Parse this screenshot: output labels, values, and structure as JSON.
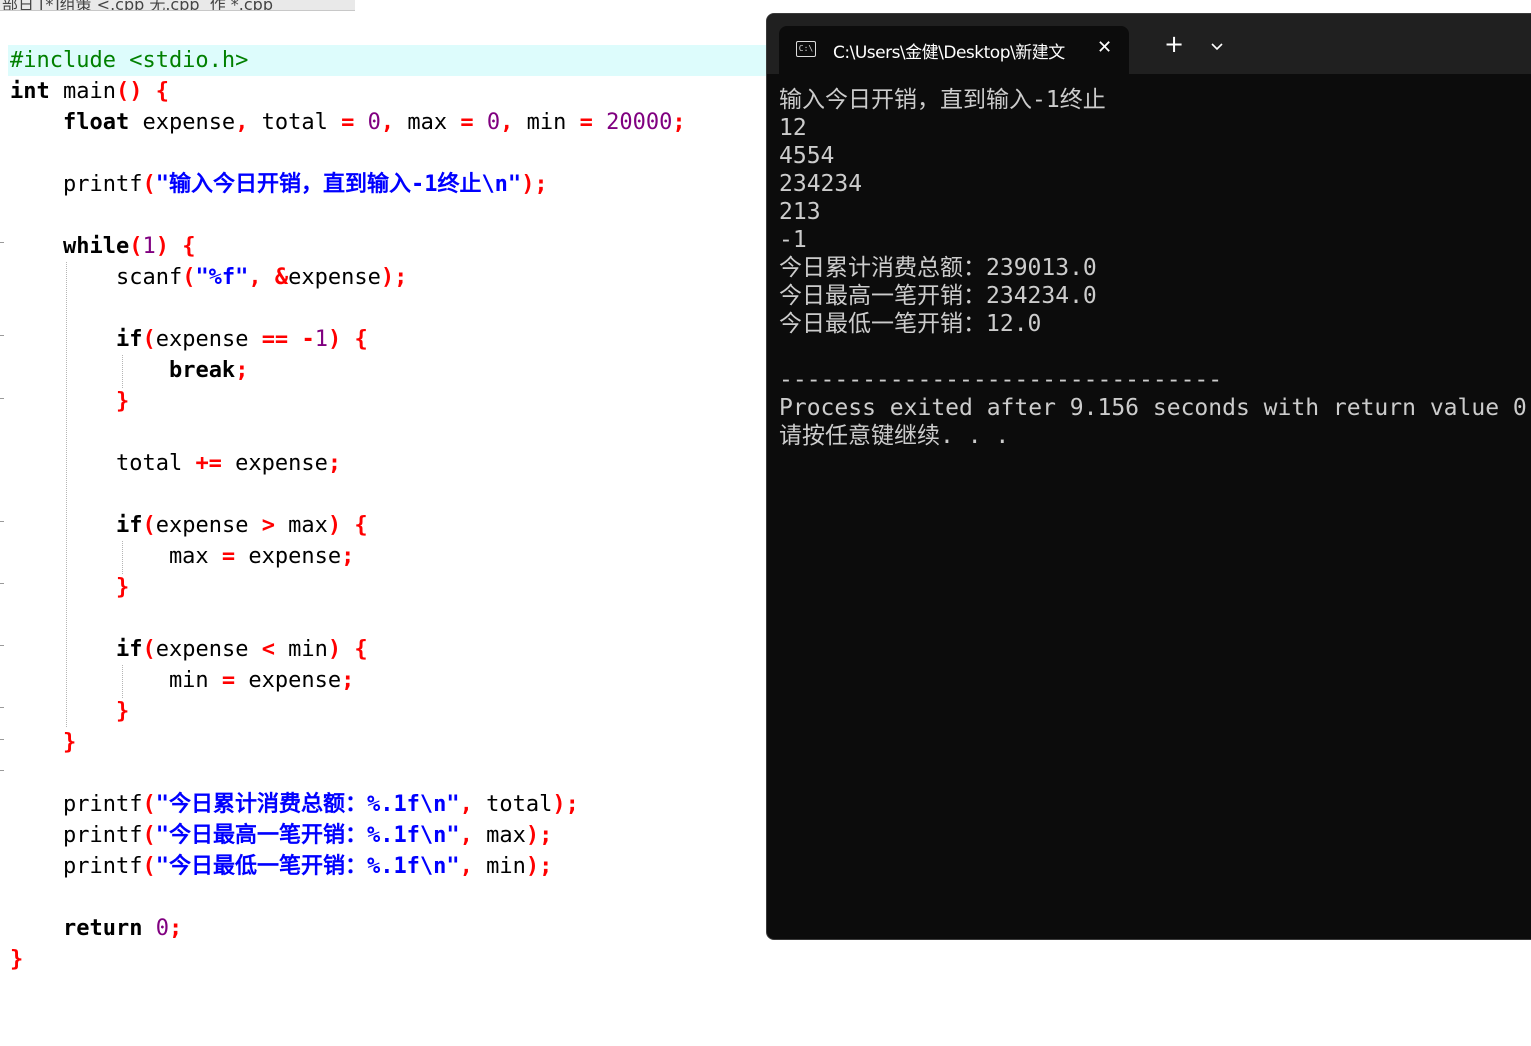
{
  "editor": {
    "tabs_label": "部日 [*]组策 <.cpp 无.cpp  作 *.cpp",
    "lines": [
      [
        {
          "t": "#include <stdio.h>",
          "c": "pp"
        }
      ],
      [
        {
          "t": "int",
          "c": "kw"
        },
        {
          "t": " main"
        },
        {
          "t": "()",
          "c": "op"
        },
        {
          "t": " "
        },
        {
          "t": "{",
          "c": "op"
        }
      ],
      [
        {
          "t": "    "
        },
        {
          "t": "float",
          "c": "kw"
        },
        {
          "t": " expense"
        },
        {
          "t": ",",
          "c": "op"
        },
        {
          "t": " total "
        },
        {
          "t": "=",
          "c": "op"
        },
        {
          "t": " "
        },
        {
          "t": "0",
          "c": "num"
        },
        {
          "t": ",",
          "c": "op"
        },
        {
          "t": " max "
        },
        {
          "t": "=",
          "c": "op"
        },
        {
          "t": " "
        },
        {
          "t": "0",
          "c": "num"
        },
        {
          "t": ",",
          "c": "op"
        },
        {
          "t": " min "
        },
        {
          "t": "=",
          "c": "op"
        },
        {
          "t": " "
        },
        {
          "t": "20000",
          "c": "num"
        },
        {
          "t": ";",
          "c": "op"
        }
      ],
      [],
      [
        {
          "t": "    printf"
        },
        {
          "t": "(",
          "c": "op"
        },
        {
          "t": "\"输入今日开销，直到输入-1终止\\n\"",
          "c": "str"
        },
        {
          "t": ");",
          "c": "op"
        }
      ],
      [],
      [
        {
          "t": "    "
        },
        {
          "t": "while",
          "c": "kw"
        },
        {
          "t": "(",
          "c": "op"
        },
        {
          "t": "1",
          "c": "num"
        },
        {
          "t": ")",
          "c": "op"
        },
        {
          "t": " "
        },
        {
          "t": "{",
          "c": "op"
        }
      ],
      [
        {
          "t": "        scanf"
        },
        {
          "t": "(",
          "c": "op"
        },
        {
          "t": "\"%f\"",
          "c": "str"
        },
        {
          "t": ",",
          "c": "op"
        },
        {
          "t": " "
        },
        {
          "t": "&",
          "c": "op"
        },
        {
          "t": "expense"
        },
        {
          "t": ");",
          "c": "op"
        }
      ],
      [],
      [
        {
          "t": "        "
        },
        {
          "t": "if",
          "c": "kw"
        },
        {
          "t": "(",
          "c": "op"
        },
        {
          "t": "expense "
        },
        {
          "t": "==",
          "c": "op"
        },
        {
          "t": " "
        },
        {
          "t": "-",
          "c": "op"
        },
        {
          "t": "1",
          "c": "num"
        },
        {
          "t": ")",
          "c": "op"
        },
        {
          "t": " "
        },
        {
          "t": "{",
          "c": "op"
        }
      ],
      [
        {
          "t": "            "
        },
        {
          "t": "break",
          "c": "kw"
        },
        {
          "t": ";",
          "c": "op"
        }
      ],
      [
        {
          "t": "        "
        },
        {
          "t": "}",
          "c": "op"
        }
      ],
      [],
      [
        {
          "t": "        total "
        },
        {
          "t": "+=",
          "c": "op"
        },
        {
          "t": " expense"
        },
        {
          "t": ";",
          "c": "op"
        }
      ],
      [],
      [
        {
          "t": "        "
        },
        {
          "t": "if",
          "c": "kw"
        },
        {
          "t": "(",
          "c": "op"
        },
        {
          "t": "expense "
        },
        {
          "t": ">",
          "c": "op"
        },
        {
          "t": " max"
        },
        {
          "t": ")",
          "c": "op"
        },
        {
          "t": " "
        },
        {
          "t": "{",
          "c": "op"
        }
      ],
      [
        {
          "t": "            max "
        },
        {
          "t": "=",
          "c": "op"
        },
        {
          "t": " expense"
        },
        {
          "t": ";",
          "c": "op"
        }
      ],
      [
        {
          "t": "        "
        },
        {
          "t": "}",
          "c": "op"
        }
      ],
      [],
      [
        {
          "t": "        "
        },
        {
          "t": "if",
          "c": "kw"
        },
        {
          "t": "(",
          "c": "op"
        },
        {
          "t": "expense "
        },
        {
          "t": "<",
          "c": "op"
        },
        {
          "t": " min"
        },
        {
          "t": ")",
          "c": "op"
        },
        {
          "t": " "
        },
        {
          "t": "{",
          "c": "op"
        }
      ],
      [
        {
          "t": "            min "
        },
        {
          "t": "=",
          "c": "op"
        },
        {
          "t": " expense"
        },
        {
          "t": ";",
          "c": "op"
        }
      ],
      [
        {
          "t": "        "
        },
        {
          "t": "}",
          "c": "op"
        }
      ],
      [
        {
          "t": "    "
        },
        {
          "t": "}",
          "c": "op"
        }
      ],
      [],
      [
        {
          "t": "    printf"
        },
        {
          "t": "(",
          "c": "op"
        },
        {
          "t": "\"今日累计消费总额：%.1f\\n\"",
          "c": "str"
        },
        {
          "t": ",",
          "c": "op"
        },
        {
          "t": " total"
        },
        {
          "t": ");",
          "c": "op"
        }
      ],
      [
        {
          "t": "    printf"
        },
        {
          "t": "(",
          "c": "op"
        },
        {
          "t": "\"今日最高一笔开销：%.1f\\n\"",
          "c": "str"
        },
        {
          "t": ",",
          "c": "op"
        },
        {
          "t": " max"
        },
        {
          "t": ");",
          "c": "op"
        }
      ],
      [
        {
          "t": "    printf"
        },
        {
          "t": "(",
          "c": "op"
        },
        {
          "t": "\"今日最低一笔开销：%.1f\\n\"",
          "c": "str"
        },
        {
          "t": ",",
          "c": "op"
        },
        {
          "t": " min"
        },
        {
          "t": ");",
          "c": "op"
        }
      ],
      [],
      [
        {
          "t": "    "
        },
        {
          "t": "return",
          "c": "kw"
        },
        {
          "t": " "
        },
        {
          "t": "0",
          "c": "num"
        },
        {
          "t": ";",
          "c": "op"
        }
      ],
      [
        {
          "t": "}",
          "c": "op"
        }
      ]
    ]
  },
  "terminal": {
    "tab_title": "C:\\Users\\金健\\Desktop\\新建文",
    "close_glyph": "✕",
    "new_tab_glyph": "+",
    "output_lines": [
      "输入今日开销，直到输入-1终止",
      "12",
      "4554",
      "234234",
      "213",
      "-1",
      "今日累计消费总额：239013.0",
      "今日最高一笔开销：234234.0",
      "今日最低一笔开销：12.0",
      "",
      "--------------------------------",
      "Process exited after 9.156 seconds with return value 0",
      "请按任意键继续. . ."
    ]
  },
  "colors": {
    "editor_background": "#ffffff",
    "current_line_highlight": "#ddfcfc",
    "preprocessor": "#008000",
    "operator": "#ff0000",
    "number": "#800080",
    "string": "#0000ff",
    "terminal_background": "#0c0c0c",
    "terminal_text": "#cccccc"
  }
}
